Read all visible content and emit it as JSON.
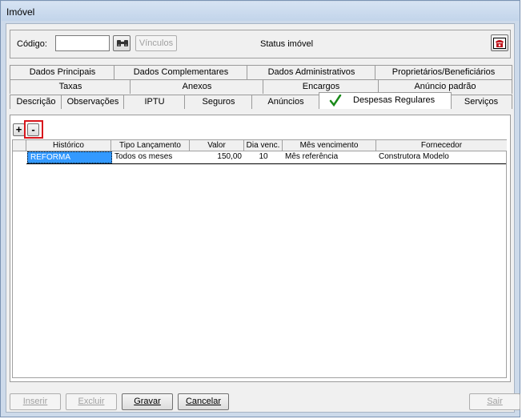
{
  "window": {
    "title": "Imóvel"
  },
  "header": {
    "codigo_label": "Código:",
    "codigo_value": "",
    "vinculos_label": "Vínculos",
    "status_label": "Status imóvel"
  },
  "tabs": {
    "row1": [
      "Dados Principais",
      "Dados Complementares",
      "Dados Administrativos",
      "Proprietários/Beneficiários"
    ],
    "row2": [
      "Taxas",
      "Anexos",
      "Encargos",
      "Anúncio padrão"
    ],
    "row3": [
      "Descrição",
      "Observações",
      "IPTU",
      "Seguros",
      "Anúncios",
      "Despesas Regulares",
      "Serviços"
    ],
    "active": "Despesas Regulares",
    "active_check_color": "#1a8a1a"
  },
  "toolbar": {
    "add_label": "+",
    "remove_label": "-"
  },
  "grid": {
    "columns": [
      "Histórico",
      "Tipo Lançamento",
      "Valor",
      "Dia venc.",
      "Mês vencimento",
      "Fornecedor"
    ],
    "rows": [
      [
        "REFORMA",
        "Todos os meses",
        "150,00",
        "10",
        "Mês referência",
        "Construtora Modelo"
      ]
    ]
  },
  "footer": {
    "inserir": "Inserir",
    "excluir": "Excluir",
    "gravar": "Gravar",
    "cancelar": "Cancelar",
    "sair": "Sair"
  },
  "colors": {
    "highlight": "#3399ff",
    "remove_box": "#d8161c"
  }
}
